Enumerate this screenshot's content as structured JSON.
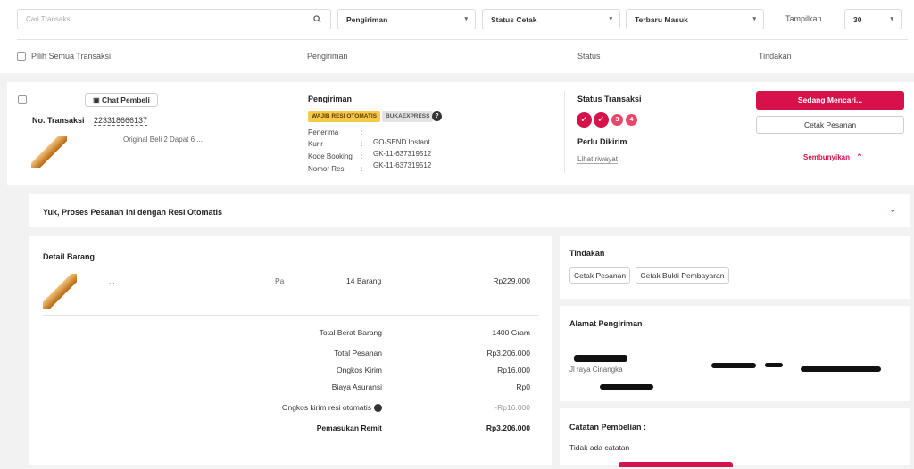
{
  "filters": {
    "search_placeholder": "Cari Transaksi",
    "pengiriman": "Pengiriman",
    "status_cetak": "Status Cetak",
    "sort": "Terbaru Masuk",
    "tampilkan_label": "Tampilkan",
    "tampilkan_value": "30"
  },
  "columns": {
    "select_all": "Pilih Semua Transaksi",
    "pengiriman": "Pengiriman",
    "status": "Status",
    "tindakan": "Tindakan"
  },
  "order": {
    "chat_label": "Chat Pembeli",
    "no_transaksi_label": "No. Transaksi",
    "no_transaksi_value": "223318666137",
    "product_snippet": "Original Beli 2 Dapat 6 ...",
    "shipping": {
      "title": "Pengiriman",
      "tag_resi": "WAJIB RESI OTOMATIS",
      "tag_courier": "BUKAEXPRESS",
      "penerima_label": "Penerima",
      "kurir_label": "Kurir",
      "kurir_value": "GO-SEND Instant",
      "kode_booking_label": "Kode Booking",
      "kode_booking_value": "GK-11-637319512",
      "nomor_resi_label": "Nomor Resi",
      "nomor_resi_value": "GK-11-637319512",
      "sep": ":"
    },
    "status": {
      "title": "Status Transaksi",
      "step3": "3",
      "step4": "4",
      "perlu_dikirim": "Perlu Dikirim",
      "riwayat": "Lihat riwayat"
    },
    "actions": {
      "primary": "Sedang Mencari...",
      "cetak": "Cetak Pesanan",
      "sembunyikan": "Sembunyikan"
    }
  },
  "banner": {
    "title": "Yuk, Proses Pesanan Ini dengan Resi Otomatis"
  },
  "detail": {
    "title": "Detail Barang",
    "item_name": "...",
    "item_variant": "Pa",
    "item_qty": "14 Barang",
    "item_price": "Rp229.000",
    "rows": [
      {
        "label": "Total Berat Barang",
        "value": "1400 Gram"
      },
      {
        "label": "Total Pesanan",
        "value": "Rp3.206.000"
      },
      {
        "label": "Ongkos Kirim",
        "value": "Rp16.000"
      },
      {
        "label": "Biaya Asuransi",
        "value": "Rp0"
      },
      {
        "label": "Ongkos kirim resi otomatis",
        "value": "-Rp16.000"
      },
      {
        "label": "Pemasukan Remit",
        "value": "Rp3.206.000"
      }
    ]
  },
  "tindakan": {
    "title": "Tindakan",
    "cetak_pesanan": "Cetak Pesanan",
    "cetak_bukti": "Cetak Bukti Pembayaran"
  },
  "alamat": {
    "title": "Alamat Pengiriman",
    "line1": "Jl raya Cinangka"
  },
  "catatan": {
    "title": "Catatan Pembelian :",
    "value": "Tidak ada catatan"
  },
  "colors": {
    "primary": "#d71149",
    "badge_yellow": "#f7c948",
    "badge_grey": "#e3e3e3"
  }
}
